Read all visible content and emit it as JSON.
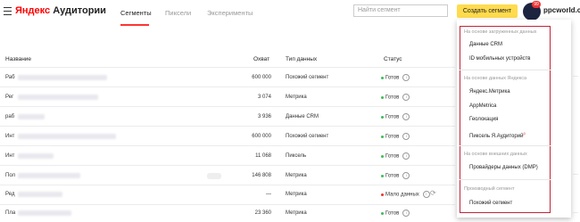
{
  "header": {
    "logo_brand": "Яндекс",
    "logo_product": "Аудитории",
    "tabs": [
      {
        "label": "Сегменты"
      },
      {
        "label": "Пиксели"
      },
      {
        "label": "Эксперименты"
      }
    ],
    "search_placeholder": "Найти сегмент",
    "create_button": "Создать сегмент",
    "notification_count": "99",
    "site": "ppcworld.co"
  },
  "table": {
    "columns": [
      "Название",
      "Охват",
      "Тип данных",
      "Статус"
    ],
    "rows": [
      {
        "name": "Раб",
        "reach": "600 000",
        "type": "Похожий сегмент",
        "status": "Готов",
        "status_color": "#3bbd5a"
      },
      {
        "name": "Рег",
        "reach": "3 074",
        "type": "Метрика",
        "status": "Готов",
        "status_color": "#3bbd5a"
      },
      {
        "name": "раб",
        "reach": "3 936",
        "type": "Данные CRM",
        "status": "Готов",
        "status_color": "#3bbd5a"
      },
      {
        "name": "Инт",
        "reach": "600 000",
        "type": "Похожий сегмент",
        "status": "Готов",
        "status_color": "#3bbd5a"
      },
      {
        "name": "Инт",
        "reach": "11 068",
        "type": "Пиксель",
        "status": "Готов",
        "status_color": "#3bbd5a"
      },
      {
        "name": "Пол",
        "reach": "146 808",
        "type": "Метрика",
        "status": "Готов",
        "status_color": "#3bbd5a"
      },
      {
        "name": "Ред",
        "reach": "—",
        "type": "Метрика",
        "status": "Мало данных",
        "status_color": "#e33"
      },
      {
        "name": "Пла",
        "reach": "23 360",
        "type": "Метрика",
        "status": "Готов",
        "status_color": "#3bbd5a"
      }
    ]
  },
  "dropdown": {
    "sections": [
      {
        "header": "На основе загруженных данных",
        "items": [
          "Данные CRM",
          "ID мобильных устройств"
        ]
      },
      {
        "header": "На основе данных Яндекса",
        "items": [
          "Яндекс.Метрика",
          "AppMetrica",
          "Геолокация",
          "Пиксель Я.Аудиторий"
        ]
      },
      {
        "header": "На основе внешних данных",
        "items": [
          "Провайдеры данных (DMP)"
        ]
      },
      {
        "header": "Производный сегмент",
        "items": [
          "Похожий сегмент"
        ]
      }
    ]
  }
}
